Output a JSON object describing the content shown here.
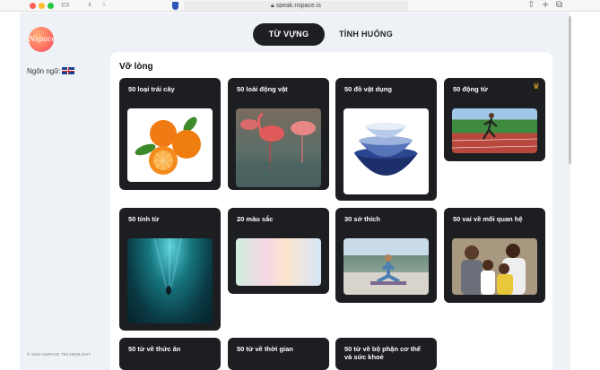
{
  "browser": {
    "url": "speak.nspace.is"
  },
  "sidebar": {
    "logo_text": "Nspace",
    "language_label": "Ngôn ngữ:",
    "copyright": "© 2024 NSPACE TECHNOLOGY"
  },
  "tabs": [
    {
      "label": "TỪ VỰNG",
      "active": true
    },
    {
      "label": "TÌNH HUỐNG",
      "active": false
    }
  ],
  "section": {
    "title": "Vỡ lòng"
  },
  "cards": [
    {
      "title": "50 loại trái cây",
      "image": "oranges"
    },
    {
      "title": "50 loài động vật",
      "image": "flamingos"
    },
    {
      "title": "50 đồ vật dụng",
      "image": "bowls"
    },
    {
      "title": "50 động từ",
      "image": "runner",
      "premium_icon": "crown-icon"
    },
    {
      "title": "50 tính từ",
      "image": "underwater-diver"
    },
    {
      "title": "20 màu sắc",
      "image": "pastel-gradient"
    },
    {
      "title": "30 sở thích",
      "image": "yoga"
    },
    {
      "title": "50 vai về mối quan hệ",
      "image": "family"
    },
    {
      "title": "50 từ về thức ăn",
      "image": ""
    },
    {
      "title": "50 từ về thời gian",
      "image": ""
    },
    {
      "title": "50 từ về bộ phận cơ thể và sức khoẻ",
      "image": ""
    }
  ],
  "colors": {
    "card_bg": "#1d1e22",
    "tab_active_bg": "#1e1f24",
    "page_bg": "#eef1f6",
    "crown": "#e6a323"
  }
}
